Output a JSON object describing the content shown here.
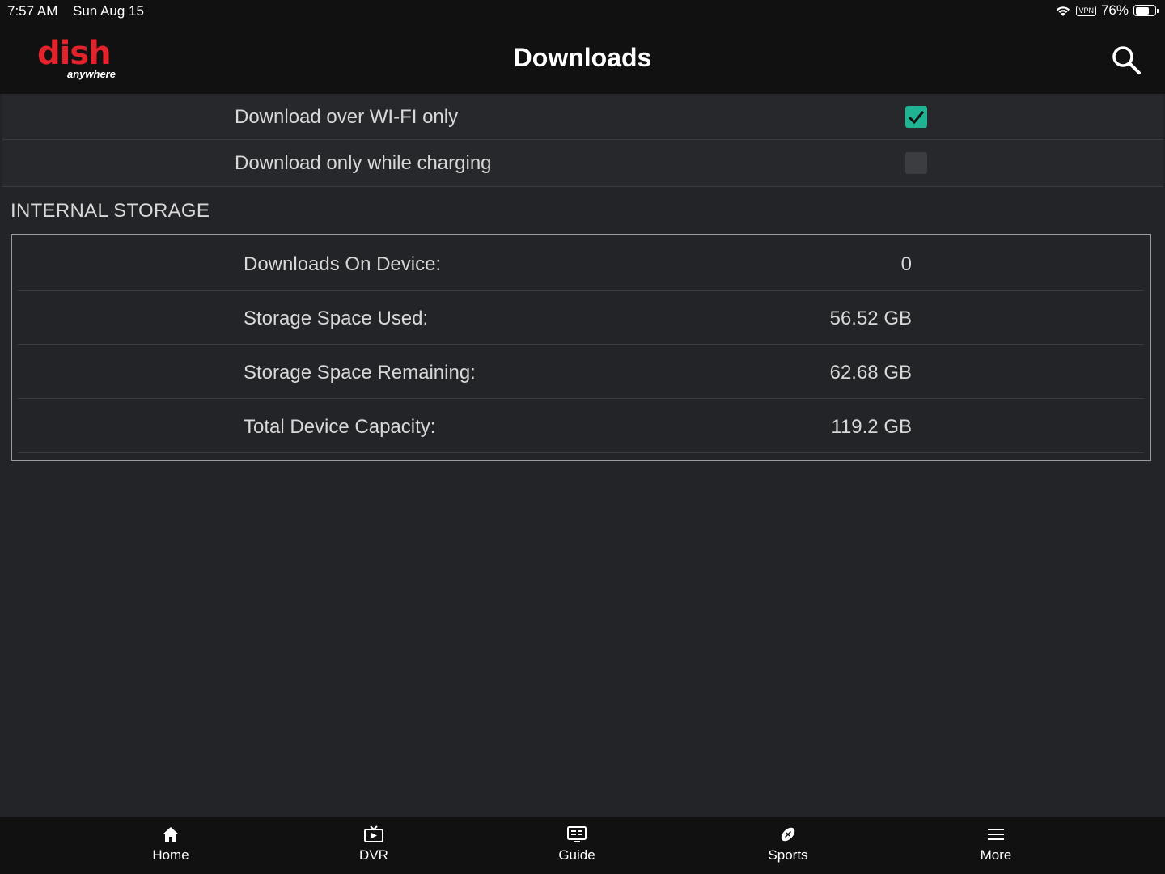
{
  "status_bar": {
    "time": "7:57 AM",
    "date": "Sun Aug 15",
    "vpn": "VPN",
    "battery": "76%",
    "battery_level": 0.76
  },
  "header": {
    "logo_word": "dish",
    "logo_sub": "anywhere",
    "title": "Downloads",
    "brand_color": "#e2232b"
  },
  "settings": [
    {
      "label": "Download over WI-FI only",
      "checked": true
    },
    {
      "label": "Download only while charging",
      "checked": false
    }
  ],
  "storage": {
    "section_title": "INTERNAL STORAGE",
    "rows": [
      {
        "key": "Downloads On Device:",
        "value": "0"
      },
      {
        "key": "Storage Space Used:",
        "value": "56.52 GB"
      },
      {
        "key": "Storage Space Remaining:",
        "value": "62.68 GB"
      },
      {
        "key": "Total Device Capacity:",
        "value": "119.2 GB"
      }
    ]
  },
  "nav": [
    {
      "label": "Home",
      "icon": "home-icon"
    },
    {
      "label": "DVR",
      "icon": "dvr-icon"
    },
    {
      "label": "Guide",
      "icon": "guide-icon"
    },
    {
      "label": "Sports",
      "icon": "football-icon"
    },
    {
      "label": "More",
      "icon": "menu-icon"
    }
  ],
  "colors": {
    "checkbox_on": "#1fb393",
    "background": "#232427",
    "bar": "#111112"
  }
}
